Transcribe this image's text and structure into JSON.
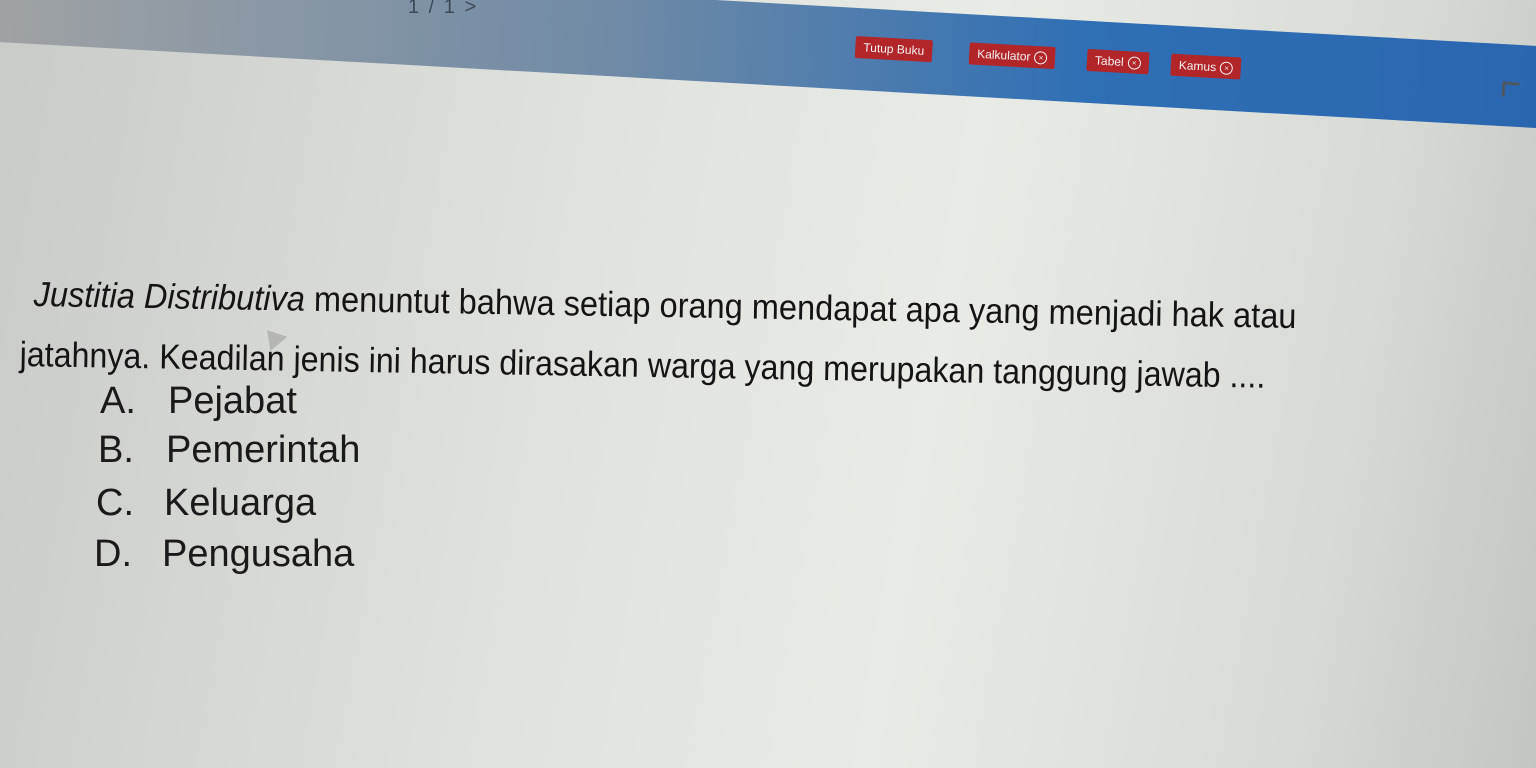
{
  "header": {
    "counter": "1 / 1 >"
  },
  "toolbar": {
    "buttons": [
      {
        "label": "Tutup Buku",
        "has_close": false
      },
      {
        "label": "Kalkulator",
        "has_close": true
      },
      {
        "label": "Tabel",
        "has_close": true
      },
      {
        "label": "Kamus",
        "has_close": true
      }
    ]
  },
  "question": {
    "italic_term": "Justitia Distributiva",
    "line1_rest": " menuntut bahwa setiap orang mendapat apa yang menjadi hak atau",
    "line2": "jatahnya. Keadilan jenis ini harus dirasakan warga yang merupakan tanggung jawab ...."
  },
  "options": [
    {
      "letter": "A.",
      "text": "Pejabat"
    },
    {
      "letter": "B.",
      "text": "Pemerintah"
    },
    {
      "letter": "C.",
      "text": "Keluarga"
    },
    {
      "letter": "D.",
      "text": "Pengusaha"
    }
  ],
  "colors": {
    "toolbar_button": "#b2262a",
    "header_bar": "#2f6fb5"
  }
}
